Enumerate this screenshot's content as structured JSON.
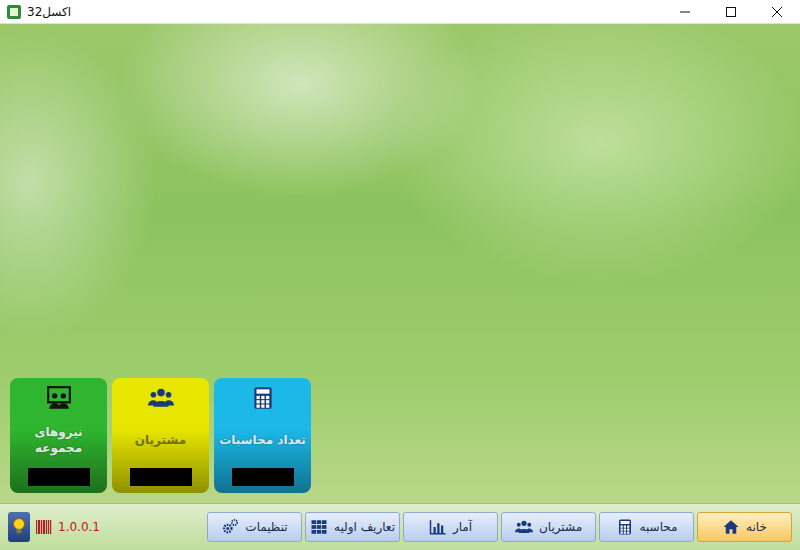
{
  "window": {
    "title": "اکسل32"
  },
  "cards": [
    {
      "label": "نیروهای مجموعه",
      "color": "#2fb52f"
    },
    {
      "label": "مشتریان",
      "color": "#e6e600"
    },
    {
      "label": "تعداد محاسبات",
      "color": "#1bb8e8"
    }
  ],
  "status": {
    "version": "1.0.0.1"
  },
  "nav": [
    {
      "label": "خانه",
      "selected": true
    },
    {
      "label": "محاسبه",
      "selected": false
    },
    {
      "label": "مشتریان",
      "selected": false
    },
    {
      "label": "آمار",
      "selected": false
    },
    {
      "label": "تعاریف اولیه",
      "selected": false
    },
    {
      "label": "تنظیمات",
      "selected": false
    }
  ]
}
